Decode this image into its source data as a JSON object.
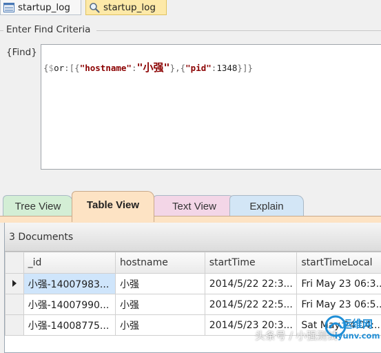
{
  "doc_tabs": [
    {
      "label": "startup_log",
      "icon": "table-icon",
      "active": false
    },
    {
      "label": "startup_log",
      "icon": "search-icon",
      "active": true
    }
  ],
  "criteria": {
    "legend": "Enter Find Criteria",
    "find_label": "{Find}",
    "query": {
      "prefix": "{",
      "dollar": "$",
      "op": "or",
      "colon_open": ":[{",
      "key1": "\"hostname\"",
      "colon1": ":",
      "val1": "\"小强\"",
      "between": "},{",
      "key2": "\"pid\"",
      "colon2": ":",
      "val2": "1348",
      "suffix": "}]}"
    }
  },
  "view_tabs": [
    {
      "label": "Tree View",
      "active": false,
      "color": "#d3eed5"
    },
    {
      "label": "Table View",
      "active": true,
      "color": "#fde3c4"
    },
    {
      "label": "Text View",
      "active": false,
      "color": "#f3d6e7"
    },
    {
      "label": "Explain",
      "active": false,
      "color": "#d3e6f6"
    }
  ],
  "grid": {
    "count_label": "3 Documents",
    "columns": [
      "_id",
      "hostname",
      "startTime",
      "startTimeLocal"
    ],
    "rows": [
      [
        "小强-14007983...",
        "小强",
        "2014/5/22 22:3...",
        "Fri May 23 06:3..."
      ],
      [
        "小强-14007990...",
        "小强",
        "2014/5/22 22:5...",
        "Fri May 23 06:5..."
      ],
      [
        "小强-14008775...",
        "小强",
        "2014/5/23 20:3...",
        "Sat May 24 04:..."
      ]
    ]
  },
  "watermark": {
    "left": "头条号 / 小强测试",
    "brand": "运维网",
    "url": "iyunv.com"
  }
}
